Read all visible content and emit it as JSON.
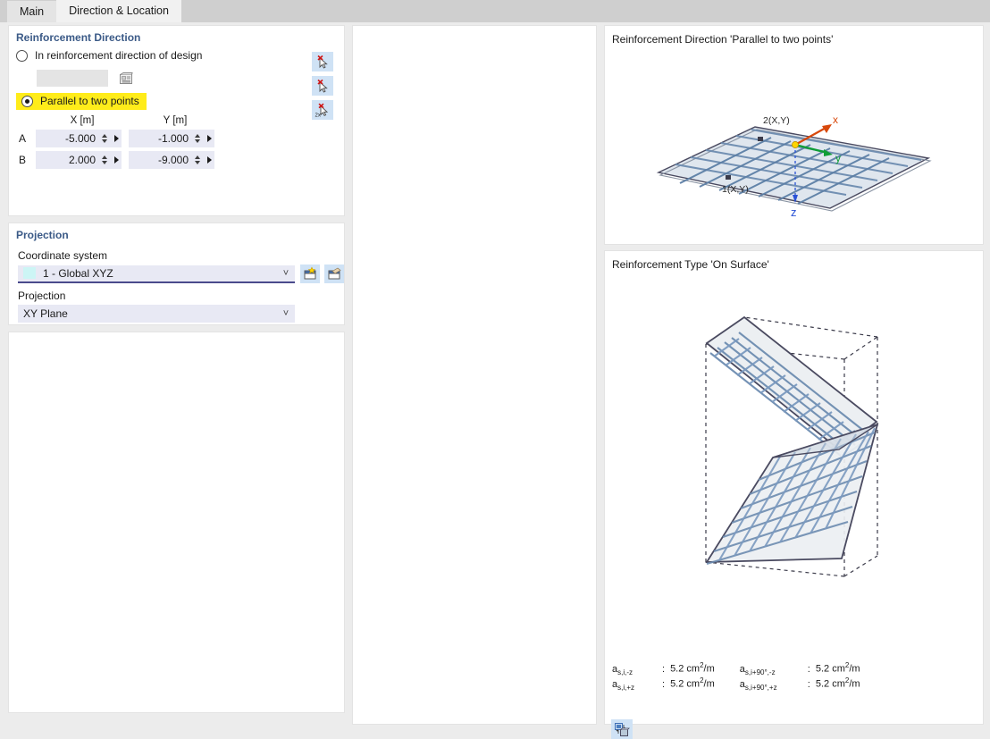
{
  "tabs": [
    {
      "label": "Main",
      "active": false
    },
    {
      "label": "Direction & Location",
      "active": true
    }
  ],
  "reinforcement_direction": {
    "group_title": "Reinforcement Direction",
    "option_design": {
      "label": "In reinforcement direction of design",
      "selected": false,
      "field_value": "",
      "button_icon": "list-picker-icon"
    },
    "option_parallel": {
      "label": "Parallel to two points",
      "selected": true,
      "highlight_color": "#ffec1a"
    },
    "columns": [
      "X [m]",
      "Y [m]"
    ],
    "rows": [
      {
        "label": "A",
        "x": "-5.000",
        "y": "-1.000"
      },
      {
        "label": "B",
        "x": "2.000",
        "y": "-9.000"
      }
    ],
    "pick_buttons": [
      "pick-point-a-icon",
      "pick-point-b-icon",
      "pick-two-points-icon"
    ]
  },
  "projection": {
    "group_title": "Projection",
    "coordinate_system_label": "Coordinate system",
    "coordinate_system_value": "1 - Global XYZ",
    "coordinate_system_swatch": "#ccf5f5",
    "new_cs_icon": "new-coordinate-system-icon",
    "edit_cs_icon": "edit-coordinate-system-icon",
    "projection_label": "Projection",
    "projection_value": "XY Plane"
  },
  "views": {
    "view1": {
      "title": "Reinforcement Direction 'Parallel to two points'",
      "labels": {
        "point1": "1(X,Y)",
        "point2": "2(X,Y)",
        "axis_x": "x",
        "axis_y": "y",
        "axis_z": "z"
      },
      "colors": {
        "axis_x": "#d8480b",
        "axis_y": "#0f9d36",
        "axis_z": "#2a52d6",
        "origin": "#ffd400"
      }
    },
    "view2": {
      "title": "Reinforcement Type 'On Surface'",
      "legend": [
        {
          "name_main": "a",
          "name_sub": "s,i,-z",
          "colon": ":",
          "value_num": "5.2",
          "value_unit_pre": "cm",
          "value_sup": "2",
          "value_unit_post": "/m"
        },
        {
          "name_main": "a",
          "name_sub": "s,i,+z",
          "colon": ":",
          "value_num": "5.2",
          "value_unit_pre": "cm",
          "value_sup": "2",
          "value_unit_post": "/m"
        },
        {
          "name_main": "a",
          "name_sub": "s,i+90°,-z",
          "colon": ":",
          "value_num": "5.2",
          "value_unit_pre": "cm",
          "value_sup": "2",
          "value_unit_post": "/m"
        },
        {
          "name_main": "a",
          "name_sub": "s,i+90°,+z",
          "colon": ":",
          "value_num": "5.2",
          "value_unit_pre": "cm",
          "value_sup": "2",
          "value_unit_post": "/m"
        }
      ],
      "toggle_icon": "toggle-view-icon"
    }
  },
  "colors": {
    "group_title": "#3b5a87",
    "window_bg": "#ececec",
    "panel_bg": "#ffffff",
    "field_bg": "#e8e9f4",
    "icon_btn_bg": "#cfe2f5",
    "mesh": "#6d8cb0",
    "outline": "#4a4a60"
  }
}
